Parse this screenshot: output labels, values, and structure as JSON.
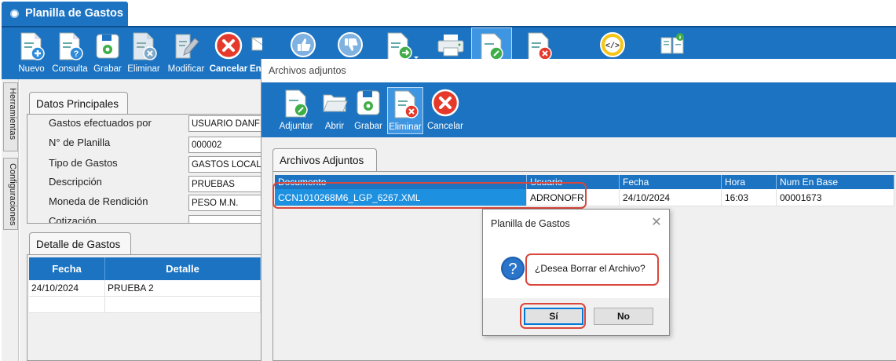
{
  "app": {
    "title": "Planilla de Gastos"
  },
  "main_toolbar": [
    {
      "id": "nuevo",
      "label": "Nuevo",
      "icon": "doc-add-icon"
    },
    {
      "id": "consulta",
      "label": "Consulta",
      "icon": "doc-query-icon"
    },
    {
      "id": "grabar",
      "label": "Grabar",
      "icon": "save-icon"
    },
    {
      "id": "eliminar",
      "label": "Eliminar",
      "icon": "doc-delete-icon"
    },
    {
      "id": "modificar",
      "label": "Modificar",
      "icon": "edit-icon"
    },
    {
      "id": "cancelar",
      "label": "Cancelar",
      "icon": "cancel-icon"
    },
    {
      "id": "enviar",
      "label": "En",
      "icon": "email-send-icon"
    }
  ],
  "side_tabs": [
    "Herramientas",
    "Configuraciones"
  ],
  "datos_principales": {
    "tab_label": "Datos Principales",
    "fields": [
      {
        "label": "Gastos efectuados por",
        "value": "USUARIO DANFIC"
      },
      {
        "label": "N° de Planilla",
        "value": "000002"
      },
      {
        "label": "Tipo de Gastos",
        "value": "GASTOS LOCALES"
      },
      {
        "label": "Descripción",
        "value": "PRUEBAS"
      },
      {
        "label": "Moneda de Rendición",
        "value": "PESO M.N."
      },
      {
        "label": "Cotización",
        "value": ""
      }
    ]
  },
  "detalle_gastos": {
    "tab_label": "Detalle de Gastos",
    "columns": [
      "Fecha",
      "Detalle"
    ],
    "rows": [
      [
        "24/10/2024",
        "PRUEBA 2"
      ]
    ]
  },
  "archivos_window": {
    "title": "Archivos adjuntos",
    "toolbar": [
      {
        "id": "adjuntar",
        "label": "Adjuntar",
        "icon": "attach-doc-icon"
      },
      {
        "id": "abrir",
        "label": "Abrir",
        "icon": "folder-open-icon"
      },
      {
        "id": "grabar",
        "label": "Grabar",
        "icon": "save-icon"
      },
      {
        "id": "eliminar",
        "label": "Eliminar",
        "icon": "doc-delete-icon",
        "selected": true
      },
      {
        "id": "cancelar",
        "label": "Cancelar",
        "icon": "cancel-icon"
      }
    ],
    "tab_label": "Archivos Adjuntos",
    "columns": [
      "Documento",
      "Usuario",
      "Fecha",
      "Hora",
      "Num En Base"
    ],
    "rows": [
      [
        "CCN1010268M6_LGP_6267.XML",
        "ADRONOFR",
        "24/10/2024",
        "16:03",
        "00001673"
      ]
    ]
  },
  "dialog": {
    "title": "Planilla de Gastos",
    "message": "¿Desea Borrar el Archivo?",
    "yes_label": "Sí",
    "no_label": "No",
    "icon": "question-icon"
  },
  "colors": {
    "accent": "#1b73c2",
    "selection": "#1e90e0",
    "highlight": "#d9463b"
  }
}
